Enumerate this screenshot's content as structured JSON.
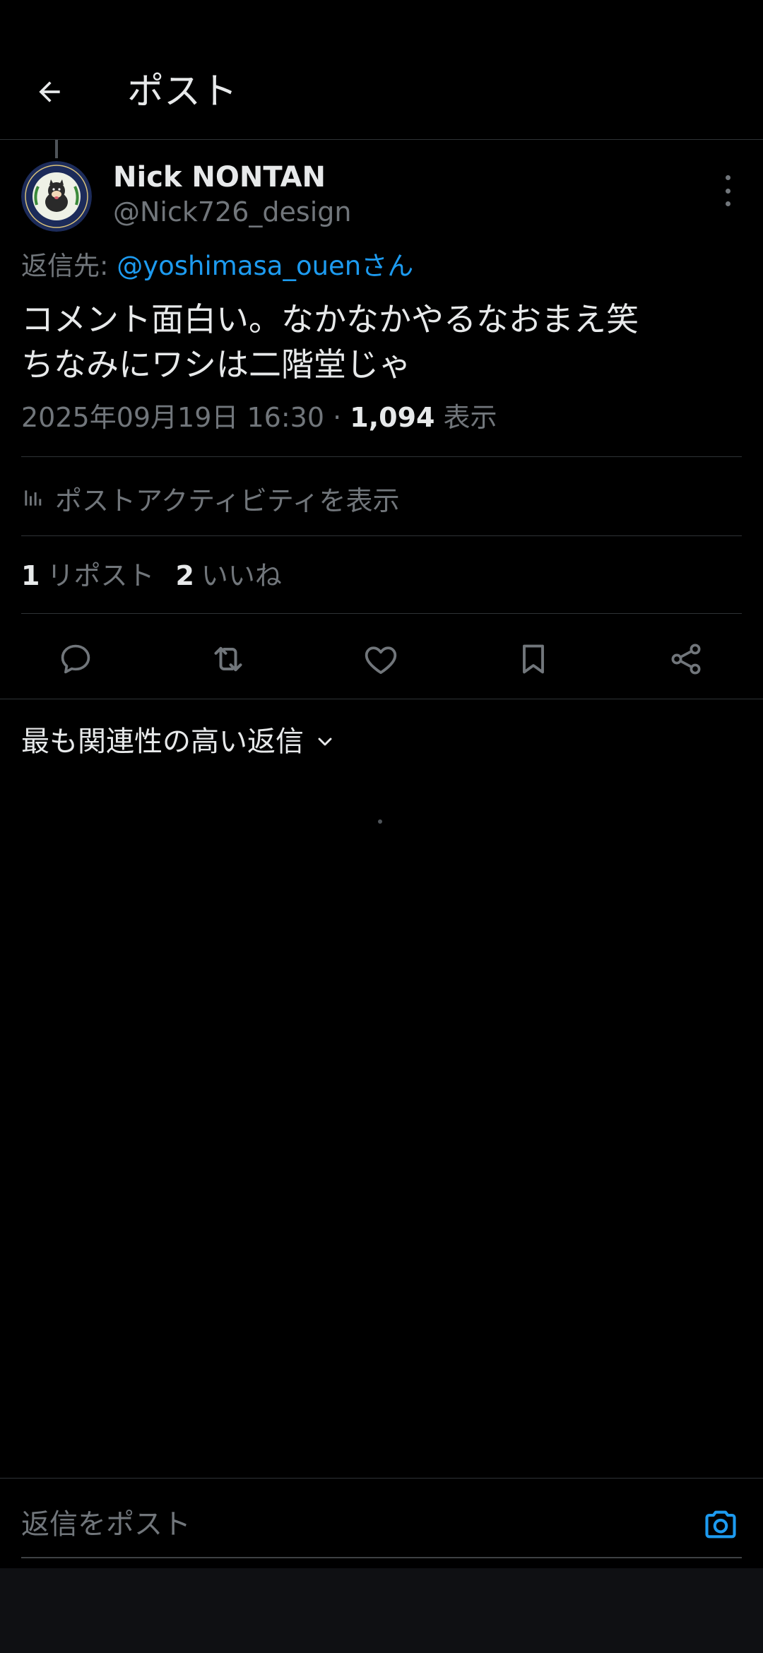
{
  "header": {
    "back_icon": "arrow-left-icon",
    "title": "ポスト"
  },
  "post": {
    "author": {
      "name": "Nick NONTAN",
      "handle": "@Nick726_design",
      "avatar_text": "NIKAIDOU.COM"
    },
    "reply_to": {
      "prefix": "返信先: ",
      "handle": "@yoshimasa_ouen",
      "suffix": "さん"
    },
    "text_lines": [
      "コメント面白い。なかなかやるなおまえ笑",
      "ちなみにワシは二階堂じゃ"
    ],
    "timestamp": "2025年09月19日 16:30",
    "separator": " · ",
    "views_count": "1,094",
    "views_label": " 表示",
    "activity_label": "ポストアクティビティを表示",
    "stats": {
      "reposts_count": "1",
      "reposts_label": "リポスト",
      "likes_count": "2",
      "likes_label": "いいね"
    },
    "actions": [
      "reply-icon",
      "repost-icon",
      "like-icon",
      "bookmark-icon",
      "share-icon"
    ]
  },
  "replies": {
    "sort_label": "最も関連性の高い返信"
  },
  "composer": {
    "placeholder": "返信をポスト",
    "camera_icon": "camera-icon"
  },
  "colors": {
    "background": "#000000",
    "text_primary": "#e7e9ea",
    "text_secondary": "#71767b",
    "accent": "#1d9bf0",
    "divider": "#2f3336"
  }
}
